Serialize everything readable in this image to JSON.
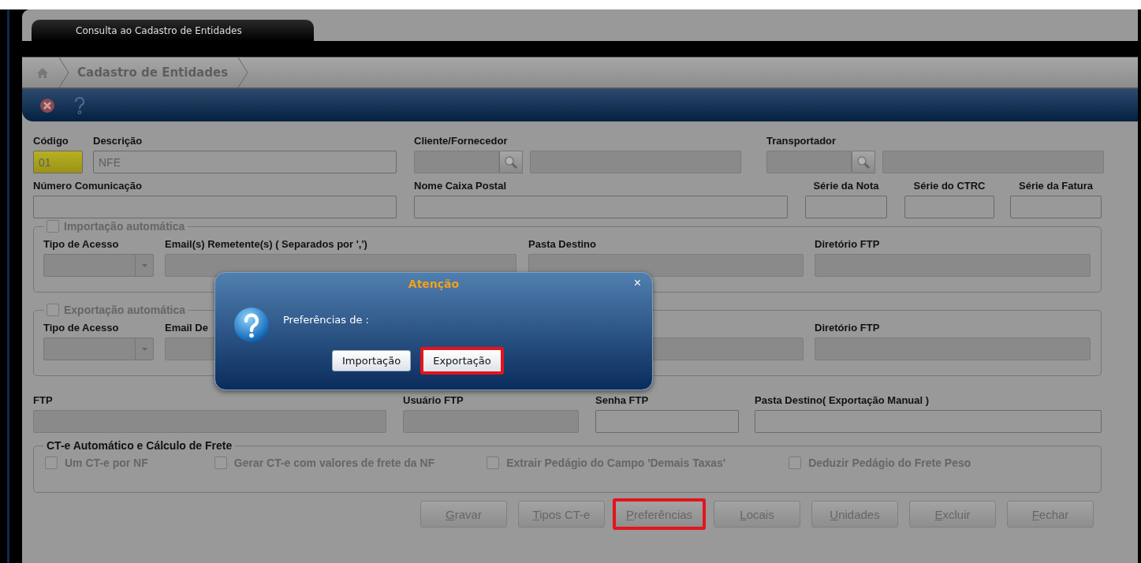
{
  "tab": {
    "title": "Consulta ao Cadastro de Entidades"
  },
  "breadcrumb": {
    "label": "Cadastro de Entidades"
  },
  "row1": [
    {
      "kind": "text",
      "label": "Código",
      "value": "01",
      "highlighted": true
    },
    {
      "kind": "text",
      "label": "Descrição",
      "value": "NFE",
      "highlighted": false
    },
    {
      "kind": "lookup",
      "label": "Cliente/Fornecedor"
    },
    {
      "kind": "lookup",
      "label": "Transportador"
    }
  ],
  "row2": [
    {
      "kind": "text",
      "label": "Número Comunicação"
    },
    {
      "kind": "text",
      "label": "Nome Caixa Postal"
    },
    {
      "kind": "text",
      "label": "Série da Nota"
    },
    {
      "kind": "text",
      "label": "Série do CTRC"
    },
    {
      "kind": "text",
      "label": "Série da Fatura"
    }
  ],
  "import": {
    "title": "Importação automática",
    "checked": false,
    "fields": [
      {
        "kind": "select",
        "label": "Tipo de Acesso"
      },
      {
        "kind": "text",
        "label": "Email(s) Remetente(s) ( Separados por ',')"
      },
      {
        "kind": "text",
        "label": "Pasta Destino"
      },
      {
        "kind": "text",
        "label": "Diretório FTP"
      }
    ]
  },
  "export": {
    "title": "Exportação automática",
    "checked": false,
    "fields": [
      {
        "kind": "select",
        "label": "Tipo de Acesso"
      },
      {
        "kind": "text",
        "label": "Email De"
      },
      {
        "kind": "text"
      },
      {
        "kind": "text",
        "label": "Diretório FTP"
      }
    ]
  },
  "ftp_row": [
    {
      "kind": "text",
      "label": "FTP",
      "disabled": true
    },
    {
      "kind": "text",
      "label": "Usuário FTP",
      "disabled": true
    },
    {
      "kind": "text",
      "label": "Senha FTP",
      "disabled": false
    },
    {
      "kind": "text",
      "label": "Pasta Destino( Exportação Manual )",
      "disabled": false
    }
  ],
  "cte": {
    "title": "CT-e Automático e Cálculo de Frete",
    "options": [
      {
        "label": "Um CT-e por NF",
        "checked": false
      },
      {
        "label": "Gerar CT-e com valores de frete da NF",
        "checked": false
      },
      {
        "label": "Extrair Pedágio do Campo 'Demais Taxas'",
        "checked": false
      },
      {
        "label": "Deduzir Pedágio do Frete Peso",
        "checked": false
      }
    ]
  },
  "buttons": [
    {
      "label": "Gravar",
      "highlighted": false
    },
    {
      "label": "Tipos CT-e",
      "highlighted": false
    },
    {
      "label": "Preferências",
      "highlighted": true
    },
    {
      "label": "Locais",
      "highlighted": false
    },
    {
      "label": "Unidades",
      "highlighted": false
    },
    {
      "label": "Excluir",
      "highlighted": false
    },
    {
      "label": "Fechar",
      "highlighted": false
    }
  ],
  "dialog": {
    "title": "Atenção",
    "close": "×",
    "message": "Preferências de :",
    "buttons": [
      {
        "label": "Importação",
        "highlighted": false
      },
      {
        "label": "Exportação",
        "highlighted": true
      }
    ]
  }
}
